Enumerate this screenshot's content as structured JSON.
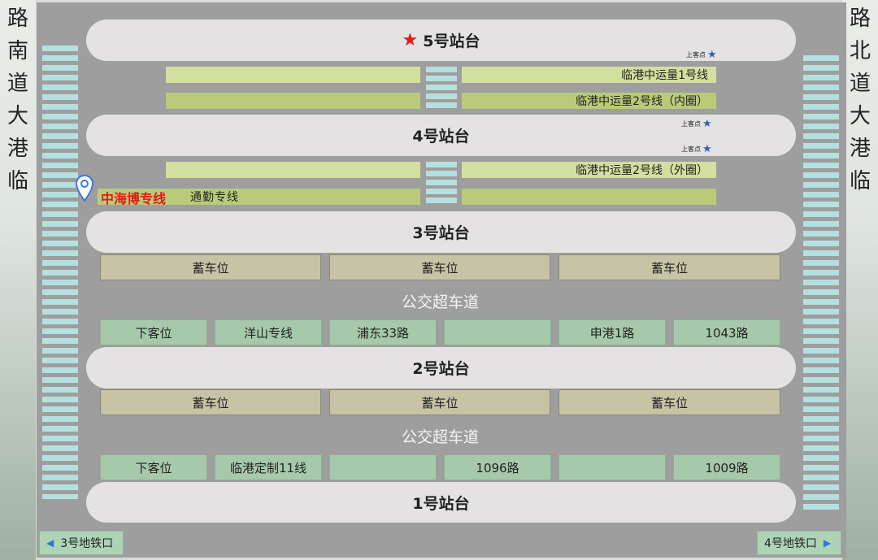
{
  "roads": {
    "left": [
      "临",
      "港",
      "大",
      "道",
      "南",
      "路"
    ],
    "right": [
      "临",
      "港",
      "大",
      "道",
      "北",
      "路"
    ]
  },
  "platforms": {
    "p5": "5号站台",
    "p4": "4号站台",
    "p3": "3号站台",
    "p2": "2号站台",
    "p1": "1号站台"
  },
  "lanes": {
    "line1": "临港中运量1号线",
    "line2_inner": "临港中运量2号线（内圈）",
    "line2_outer": "临港中运量2号线（外圈）"
  },
  "special": {
    "zhb": "中海博专线",
    "commute": "通勤专线"
  },
  "boarding_label": "上客点",
  "bus_lane": "公交超车道",
  "row_a_store": [
    "蓄车位",
    "蓄车位",
    "蓄车位"
  ],
  "row_a_stops": [
    "下客位",
    "洋山专线",
    "浦东33路",
    "",
    "申港1路",
    "1043路"
  ],
  "row_b_store": [
    "蓄车位",
    "蓄车位",
    "蓄车位"
  ],
  "row_b_stops": [
    "下客位",
    "临港定制11线",
    "",
    "1096路",
    "",
    "1009路"
  ],
  "exits": {
    "left": "3号地铁口",
    "right": "4号地铁口"
  },
  "colors": {
    "platform": "#e4e2e3",
    "star": "#e21b1b",
    "boarding_star": "#2b5fc7",
    "pin": "#3a7bd5",
    "zebra": "#b5e0e0",
    "plaza": "#9e9e9e"
  },
  "icons": {
    "star": "red-star-icon",
    "boarding": "blue-star-icon",
    "pin": "location-pin-icon",
    "arrow_left": "arrow-left-icon",
    "arrow_right": "arrow-right-icon"
  }
}
